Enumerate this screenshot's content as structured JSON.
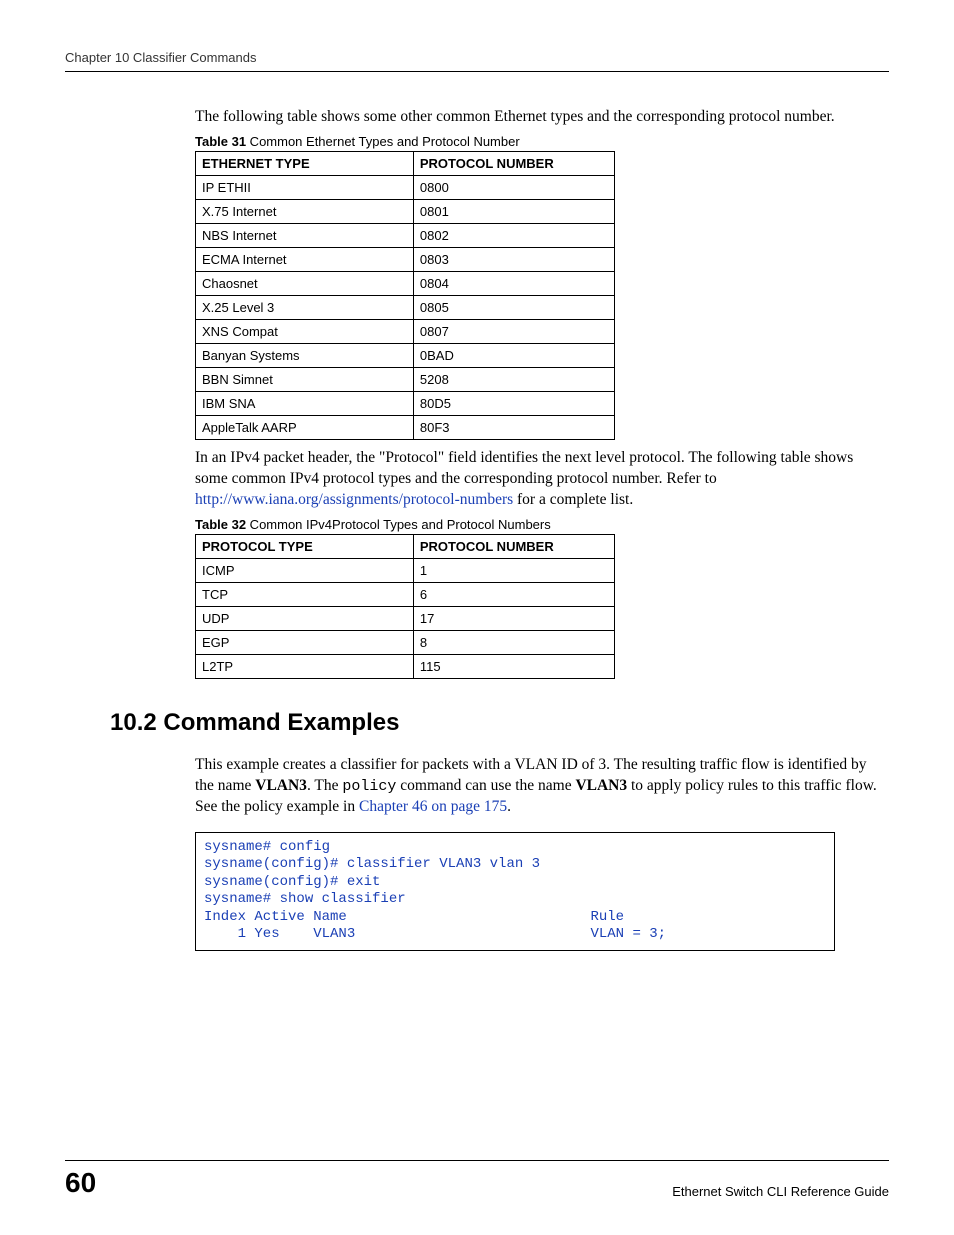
{
  "header": {
    "chapter": "Chapter 10 Classifier Commands"
  },
  "intro1": "The following table shows some other common Ethernet types and the corresponding protocol number.",
  "table31": {
    "caption_bold": "Table 31",
    "caption_rest": "   Common Ethernet Types and Protocol Number",
    "headers": {
      "col1": "ETHERNET TYPE",
      "col2": "PROTOCOL NUMBER"
    },
    "rows": [
      {
        "type": "IP ETHII",
        "num": "0800"
      },
      {
        "type": "X.75 Internet",
        "num": "0801"
      },
      {
        "type": "NBS Internet",
        "num": "0802"
      },
      {
        "type": "ECMA Internet",
        "num": "0803"
      },
      {
        "type": "Chaosnet",
        "num": "0804"
      },
      {
        "type": "X.25 Level 3",
        "num": "0805"
      },
      {
        "type": "XNS Compat",
        "num": "0807"
      },
      {
        "type": "Banyan Systems",
        "num": "0BAD"
      },
      {
        "type": "BBN Simnet",
        "num": "5208"
      },
      {
        "type": "IBM SNA",
        "num": "80D5"
      },
      {
        "type": "AppleTalk AARP",
        "num": "80F3"
      }
    ]
  },
  "intro2_part1": "In an IPv4 packet header, the \"Protocol\" field identifies the next level protocol. The following table shows some common IPv4 protocol types and the corresponding protocol number. Refer to ",
  "intro2_link": "http://www.iana.org/assignments/protocol-numbers",
  "intro2_part2": " for a complete list.",
  "table32": {
    "caption_bold": "Table 32",
    "caption_rest": "   Common IPv4Protocol Types and Protocol Numbers",
    "headers": {
      "col1": "PROTOCOL TYPE",
      "col2": "PROTOCOL NUMBER"
    },
    "rows": [
      {
        "type": "ICMP",
        "num": "1"
      },
      {
        "type": "TCP",
        "num": "6"
      },
      {
        "type": "UDP",
        "num": "17"
      },
      {
        "type": "EGP",
        "num": "8"
      },
      {
        "type": "L2TP",
        "num": "115"
      }
    ]
  },
  "section": {
    "heading": "10.2  Command Examples",
    "para_part1": "This example creates a classifier for packets with a VLAN ID of 3. The resulting traffic flow is identified by the name ",
    "bold1": "VLAN3",
    "para_part2": ". The ",
    "mono1": "policy",
    "para_part3": " command can use the name ",
    "bold2": "VLAN3",
    "para_part4": " to apply policy rules to this traffic flow. See the policy example in ",
    "xref": "Chapter 46 on page 175",
    "para_part5": "."
  },
  "code": "sysname# config\nsysname(config)# classifier VLAN3 vlan 3\nsysname(config)# exit\nsysname# show classifier\nIndex Active Name                             Rule\n    1 Yes    VLAN3                            VLAN = 3;",
  "footer": {
    "page": "60",
    "title": "Ethernet Switch CLI Reference Guide"
  }
}
